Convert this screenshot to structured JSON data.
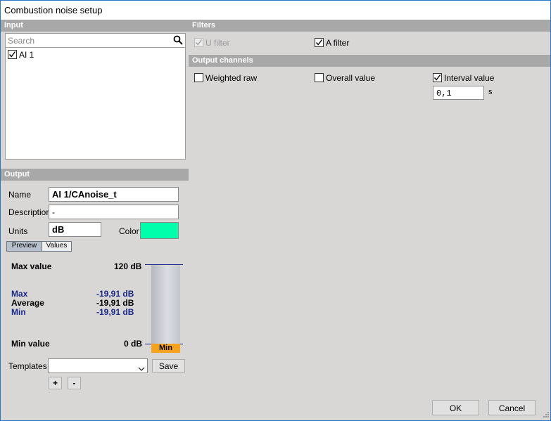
{
  "window": {
    "title": "Combustion noise setup"
  },
  "input_section": {
    "header": "Input",
    "search_placeholder": "Search",
    "channels": [
      {
        "label": "AI 1",
        "checked": true
      }
    ]
  },
  "filters_section": {
    "header": "Filters",
    "u_filter": {
      "label": "U filter",
      "checked": true,
      "enabled": false
    },
    "a_filter": {
      "label": "A filter",
      "checked": true,
      "enabled": true
    }
  },
  "output_channels_section": {
    "header": "Output channels",
    "weighted_raw": {
      "label": "Weighted raw",
      "checked": false
    },
    "overall_value": {
      "label": "Overall value",
      "checked": false
    },
    "interval_value": {
      "label": "Interval value",
      "checked": true
    },
    "interval_input": "0,1",
    "interval_unit": "s"
  },
  "output_section": {
    "header": "Output",
    "name_label": "Name",
    "name_value": "AI 1/CAnoise_t",
    "description_label": "Description",
    "description_value": "-",
    "units_label": "Units",
    "units_value": "dB",
    "color_label": "Color",
    "color_value": "#00ffaa",
    "tabs": [
      {
        "label": "Preview",
        "active": true
      },
      {
        "label": "Values",
        "active": false
      }
    ]
  },
  "preview": {
    "max_value_label": "Max value",
    "max_value": "120 dB",
    "min_value_label": "Min value",
    "min_value": "0 dB",
    "stats": [
      {
        "label": "Max",
        "value": "-19,91 dB",
        "color": "#1b2a8a"
      },
      {
        "label": "Average",
        "value": "-19,91 dB",
        "color": "#000000"
      },
      {
        "label": "Min",
        "value": "-19,91 dB",
        "color": "#1b2a8a"
      }
    ],
    "bar_indicator": "Min",
    "bar_fill_color": "#f5a31e"
  },
  "templates": {
    "label": "Templates",
    "selected": "",
    "save_label": "Save",
    "add_label": "+",
    "remove_label": "-"
  },
  "footer": {
    "ok_label": "OK",
    "cancel_label": "Cancel"
  }
}
